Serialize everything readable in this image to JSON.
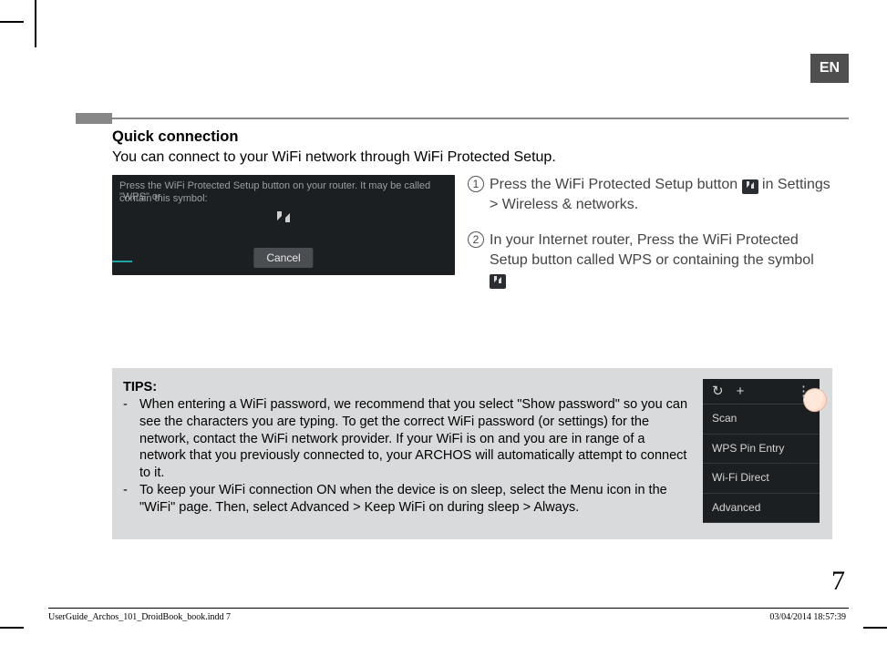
{
  "lang_tab": "EN",
  "heading": "Quick connection",
  "intro": "You can connect to your WiFi network through WiFi Protected Setup.",
  "wps_dialog": {
    "line1": "Press the WiFi Protected Setup button on your router. It may be called \"WPS\" or",
    "line2": "contain this symbol:",
    "cancel": "Cancel"
  },
  "steps": {
    "n1": "1",
    "text1a": "Press the WiFi Protected Setup button ",
    "text1b": " in Settings > Wireless & networks.",
    "n2": "2",
    "text2a": "In your Internet router, Press the WiFi Protected Setup button called WPS or containing the symbol "
  },
  "tips": {
    "label": "TIPS:",
    "dash": "-",
    "t1": "When entering a WiFi password, we recommend that you select \"Show password\" so you can see the characters you are typing. To get the correct WiFi password (or settings) for the network, contact the WiFi network provider. If your WiFi is on and you are in range of a network that you previously connected to, your ARCHOS will automatically attempt to connect to it.",
    "t2": "To keep your WiFi connection ON when the device is on sleep, select the Menu icon in the \"WiFi\" page. Then, select Advanced > Keep WiFi on during sleep > Always."
  },
  "menu": {
    "refresh": "↻",
    "add": "+",
    "more": "⋮",
    "items": [
      "Scan",
      "WPS Pin Entry",
      "Wi-Fi Direct",
      "Advanced"
    ]
  },
  "page_number": "7",
  "footer_left": "UserGuide_Archos_101_DroidBook_book.indd   7",
  "footer_right": "03/04/2014   18:57:39"
}
